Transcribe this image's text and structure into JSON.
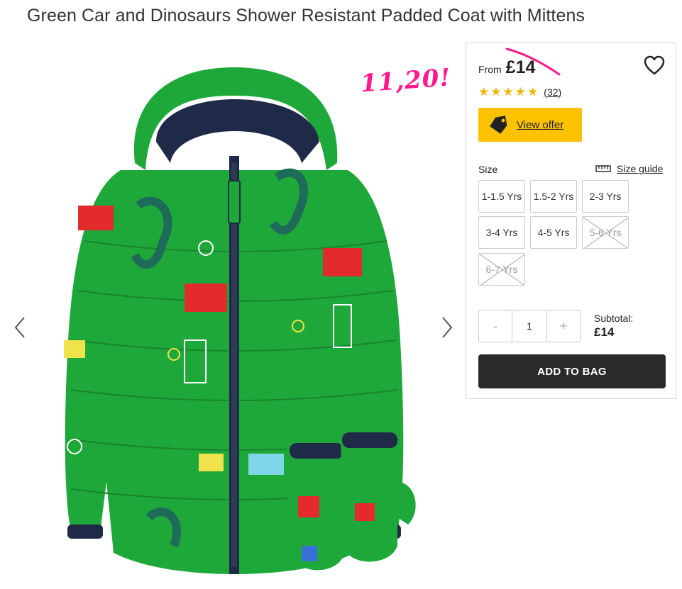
{
  "product": {
    "title": "Green Car and Dinosaurs Shower Resistant Padded Coat with Mittens",
    "handwritten_price": "11,20!"
  },
  "gallery": {
    "prev_icon": "chevron-left-icon",
    "next_icon": "chevron-right-icon",
    "image": "green padded coat with mittens product photo"
  },
  "panel": {
    "from_label": "From",
    "price": "£14",
    "wishlist_icon": "heart-icon",
    "rating": 5,
    "review_count": "(32)",
    "offer_label": "View offer",
    "size_label": "Size",
    "size_guide_label": "Size guide",
    "sizes": [
      {
        "label": "1-1.5 Yrs",
        "available": true
      },
      {
        "label": "1.5-2 Yrs",
        "available": true
      },
      {
        "label": "2-3 Yrs",
        "available": true
      },
      {
        "label": "3-4 Yrs",
        "available": true
      },
      {
        "label": "4-5 Yrs",
        "available": true
      },
      {
        "label": "5-6 Yrs",
        "available": false
      },
      {
        "label": "6-7 Yrs",
        "available": false
      }
    ],
    "quantity": {
      "minus": "-",
      "value": "1",
      "plus": "+"
    },
    "subtotal_label": "Subtotal:",
    "subtotal_value": "£14",
    "add_to_bag": "ADD TO BAG"
  },
  "colors": {
    "accent_yellow": "#fcc200",
    "handwriting_pink": "#ff1a8c",
    "button_dark": "#2a2a2a",
    "star": "#f5b400",
    "coat_green": "#1fa83a"
  }
}
